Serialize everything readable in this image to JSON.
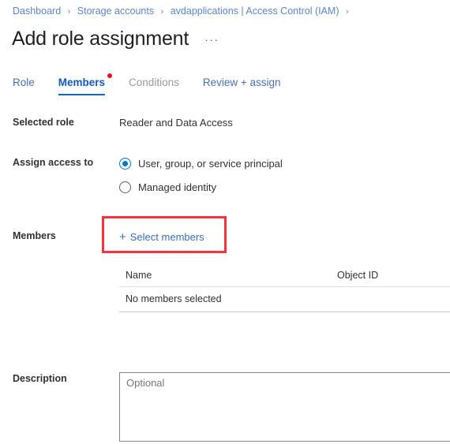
{
  "breadcrumb": {
    "items": [
      {
        "label": "Dashboard"
      },
      {
        "label": "Storage accounts"
      },
      {
        "label": "avdapplications | Access Control (IAM)"
      }
    ],
    "separator": "›"
  },
  "header": {
    "title": "Add role assignment",
    "more_label": "···"
  },
  "tabs": [
    {
      "label": "Role",
      "state": "default"
    },
    {
      "label": "Members",
      "state": "active",
      "badge": "dot"
    },
    {
      "label": "Conditions",
      "state": "disabled"
    },
    {
      "label": "Review + assign",
      "state": "default"
    }
  ],
  "form": {
    "selected_role": {
      "label": "Selected role",
      "value": "Reader and Data Access"
    },
    "assign_access_to": {
      "label": "Assign access to",
      "options": [
        {
          "label": "User, group, or service principal",
          "checked": true
        },
        {
          "label": "Managed identity",
          "checked": false
        }
      ]
    },
    "members": {
      "label": "Members",
      "select_members_label": "Select members",
      "plus_icon": "+",
      "table": {
        "columns": [
          "Name",
          "Object ID"
        ],
        "empty_message": "No members selected"
      }
    },
    "description": {
      "label": "Description",
      "placeholder": "Optional",
      "value": ""
    }
  },
  "colors": {
    "accent": "#0078d4",
    "link": "#3b6db5",
    "breadcrumb_link": "#5b87c7",
    "highlight": "#f5333f",
    "badge_dot": "#e81123",
    "disabled_text": "#9a9a9a"
  }
}
